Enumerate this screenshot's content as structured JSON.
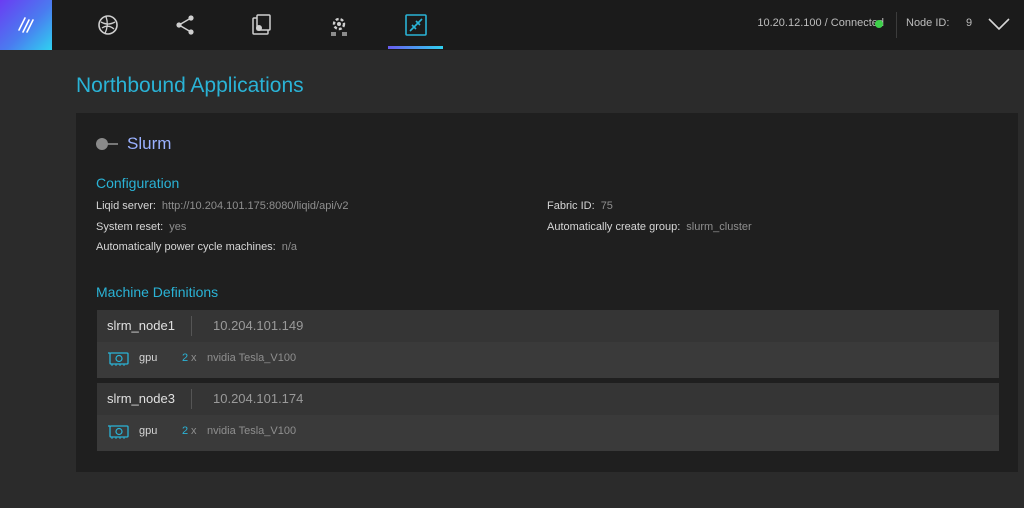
{
  "header": {
    "connection_text": "10.20.12.100 / Connected",
    "node_id_label": "Node ID:",
    "node_id_value": "9",
    "accent": "#2ab3d6",
    "status_color": "#3ecf4a",
    "nav_icons": [
      "dashboard-icon",
      "share-network-icon",
      "devices-icon",
      "settings-gear-icon",
      "northbound-apps-icon"
    ],
    "active_nav": "northbound-apps-icon"
  },
  "page": {
    "title": "Northbound Applications"
  },
  "app": {
    "name": "Slurm",
    "enabled": false,
    "configuration": {
      "title": "Configuration",
      "liqid_server_label": "Liqid server:",
      "liqid_server_value": "http://10.204.101.175:8080/liqid/api/v2",
      "system_reset_label": "System reset:",
      "system_reset_value": "yes",
      "power_cycle_label": "Automatically power cycle machines:",
      "power_cycle_value": "n/a",
      "fabric_id_label": "Fabric ID:",
      "fabric_id_value": "75",
      "create_group_label": "Automatically create group:",
      "create_group_value": "slurm_cluster"
    },
    "machine_definitions": {
      "title": "Machine Definitions",
      "machines": [
        {
          "name": "slrm_node1",
          "ip": "10.204.101.149",
          "device_type": "gpu",
          "count": "2",
          "multiplier": "x",
          "model": "nvidia Tesla_V100"
        },
        {
          "name": "slrm_node3",
          "ip": "10.204.101.174",
          "device_type": "gpu",
          "count": "2",
          "multiplier": "x",
          "model": "nvidia Tesla_V100"
        }
      ]
    }
  }
}
